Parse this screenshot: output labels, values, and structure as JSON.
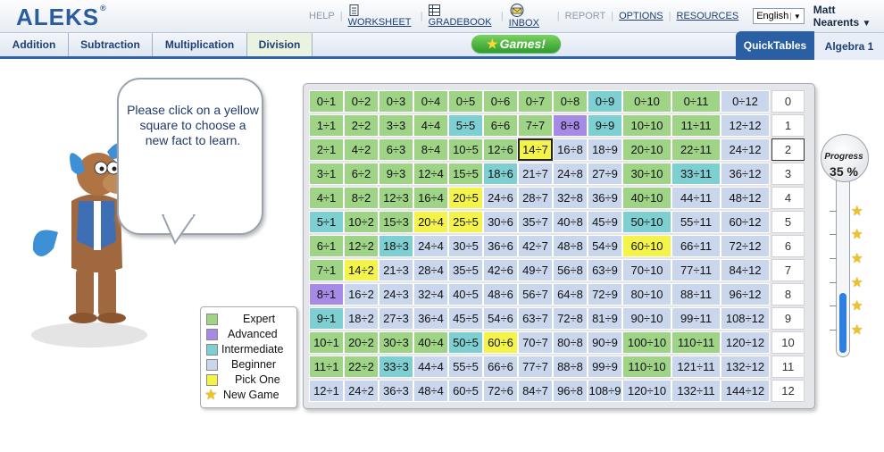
{
  "header": {
    "logo": "ALEKS",
    "logo_mark": "®",
    "links": {
      "help": "HELP",
      "worksheet": "WORKSHEET",
      "gradebook": "GRADEBOOK",
      "inbox": "INBOX",
      "report": "REPORT",
      "options": "OPTIONS",
      "resources": "RESOURCES"
    },
    "language": "English",
    "user": "Matt Nearents"
  },
  "nav": {
    "tabs": [
      "Addition",
      "Subtraction",
      "Multiplication",
      "Division"
    ],
    "games": "Games!",
    "quicktables": "QuickTables",
    "course": "Algebra 1"
  },
  "bubble": {
    "text": "Please click on a yellow square to choose a new fact to learn."
  },
  "legend": [
    {
      "label": "Expert",
      "color": "#9fd487"
    },
    {
      "label": "Advanced",
      "color": "#a58be6"
    },
    {
      "label": "Intermediate",
      "color": "#7ecfd2"
    },
    {
      "label": "Beginner",
      "color": "#c9d6ec"
    },
    {
      "label": "Pick One",
      "color": "#f3f34a"
    },
    {
      "label": "New Game",
      "icon": "star-icon"
    }
  ],
  "progress": {
    "label": "Progress",
    "value": "35 %",
    "fraction": 0.35
  },
  "colors": {
    "E": "#9fd487",
    "A": "#a58be6",
    "I": "#7ecfd2",
    "B": "#c9d6ec",
    "P": "#f3f34a",
    "S": "#f3f34a"
  },
  "table": {
    "row_labels": [
      "0",
      "1",
      "2",
      "3",
      "4",
      "5",
      "6",
      "7",
      "8",
      "9",
      "10",
      "11",
      "12"
    ],
    "current_row": 2,
    "rows": [
      [
        [
          "0÷1",
          "E"
        ],
        [
          "0÷2",
          "E"
        ],
        [
          "0÷3",
          "E"
        ],
        [
          "0÷4",
          "E"
        ],
        [
          "0÷5",
          "E"
        ],
        [
          "0÷6",
          "E"
        ],
        [
          "0÷7",
          "E"
        ],
        [
          "0÷8",
          "E"
        ],
        [
          "0÷9",
          "I"
        ],
        [
          "0÷10",
          "E"
        ],
        [
          "0÷11",
          "E"
        ],
        [
          "0÷12",
          "B"
        ]
      ],
      [
        [
          "1÷1",
          "E"
        ],
        [
          "2÷2",
          "E"
        ],
        [
          "3÷3",
          "E"
        ],
        [
          "4÷4",
          "E"
        ],
        [
          "5÷5",
          "I"
        ],
        [
          "6÷6",
          "E"
        ],
        [
          "7÷7",
          "E"
        ],
        [
          "8÷8",
          "A"
        ],
        [
          "9÷9",
          "I"
        ],
        [
          "10÷10",
          "E"
        ],
        [
          "11÷11",
          "E"
        ],
        [
          "12÷12",
          "B"
        ]
      ],
      [
        [
          "2÷1",
          "E"
        ],
        [
          "4÷2",
          "E"
        ],
        [
          "6÷3",
          "E"
        ],
        [
          "8÷4",
          "E"
        ],
        [
          "10÷5",
          "E"
        ],
        [
          "12÷6",
          "E"
        ],
        [
          "14÷7",
          "S"
        ],
        [
          "16÷8",
          "B"
        ],
        [
          "18÷9",
          "B"
        ],
        [
          "20÷10",
          "E"
        ],
        [
          "22÷11",
          "E"
        ],
        [
          "24÷12",
          "B"
        ]
      ],
      [
        [
          "3÷1",
          "E"
        ],
        [
          "6÷2",
          "E"
        ],
        [
          "9÷3",
          "E"
        ],
        [
          "12÷4",
          "E"
        ],
        [
          "15÷5",
          "E"
        ],
        [
          "18÷6",
          "I"
        ],
        [
          "21÷7",
          "B"
        ],
        [
          "24÷8",
          "B"
        ],
        [
          "27÷9",
          "B"
        ],
        [
          "30÷10",
          "E"
        ],
        [
          "33÷11",
          "I"
        ],
        [
          "36÷12",
          "B"
        ]
      ],
      [
        [
          "4÷1",
          "E"
        ],
        [
          "8÷2",
          "E"
        ],
        [
          "12÷3",
          "E"
        ],
        [
          "16÷4",
          "E"
        ],
        [
          "20÷5",
          "P"
        ],
        [
          "24÷6",
          "B"
        ],
        [
          "28÷7",
          "B"
        ],
        [
          "32÷8",
          "B"
        ],
        [
          "36÷9",
          "B"
        ],
        [
          "40÷10",
          "E"
        ],
        [
          "44÷11",
          "B"
        ],
        [
          "48÷12",
          "B"
        ]
      ],
      [
        [
          "5÷1",
          "I"
        ],
        [
          "10÷2",
          "E"
        ],
        [
          "15÷3",
          "E"
        ],
        [
          "20÷4",
          "P"
        ],
        [
          "25÷5",
          "P"
        ],
        [
          "30÷6",
          "B"
        ],
        [
          "35÷7",
          "B"
        ],
        [
          "40÷8",
          "B"
        ],
        [
          "45÷9",
          "B"
        ],
        [
          "50÷10",
          "I"
        ],
        [
          "55÷11",
          "B"
        ],
        [
          "60÷12",
          "B"
        ]
      ],
      [
        [
          "6÷1",
          "E"
        ],
        [
          "12÷2",
          "E"
        ],
        [
          "18÷3",
          "I"
        ],
        [
          "24÷4",
          "B"
        ],
        [
          "30÷5",
          "B"
        ],
        [
          "36÷6",
          "B"
        ],
        [
          "42÷7",
          "B"
        ],
        [
          "48÷8",
          "B"
        ],
        [
          "54÷9",
          "B"
        ],
        [
          "60÷10",
          "P"
        ],
        [
          "66÷11",
          "B"
        ],
        [
          "72÷12",
          "B"
        ]
      ],
      [
        [
          "7÷1",
          "E"
        ],
        [
          "14÷2",
          "P"
        ],
        [
          "21÷3",
          "B"
        ],
        [
          "28÷4",
          "B"
        ],
        [
          "35÷5",
          "B"
        ],
        [
          "42÷6",
          "B"
        ],
        [
          "49÷7",
          "B"
        ],
        [
          "56÷8",
          "B"
        ],
        [
          "63÷9",
          "B"
        ],
        [
          "70÷10",
          "B"
        ],
        [
          "77÷11",
          "B"
        ],
        [
          "84÷12",
          "B"
        ]
      ],
      [
        [
          "8÷1",
          "A"
        ],
        [
          "16÷2",
          "B"
        ],
        [
          "24÷3",
          "B"
        ],
        [
          "32÷4",
          "B"
        ],
        [
          "40÷5",
          "B"
        ],
        [
          "48÷6",
          "B"
        ],
        [
          "56÷7",
          "B"
        ],
        [
          "64÷8",
          "B"
        ],
        [
          "72÷9",
          "B"
        ],
        [
          "80÷10",
          "B"
        ],
        [
          "88÷11",
          "B"
        ],
        [
          "96÷12",
          "B"
        ]
      ],
      [
        [
          "9÷1",
          "I"
        ],
        [
          "18÷2",
          "B"
        ],
        [
          "27÷3",
          "B"
        ],
        [
          "36÷4",
          "B"
        ],
        [
          "45÷5",
          "B"
        ],
        [
          "54÷6",
          "B"
        ],
        [
          "63÷7",
          "B"
        ],
        [
          "72÷8",
          "B"
        ],
        [
          "81÷9",
          "B"
        ],
        [
          "90÷10",
          "B"
        ],
        [
          "99÷11",
          "B"
        ],
        [
          "108÷12",
          "B"
        ]
      ],
      [
        [
          "10÷1",
          "E"
        ],
        [
          "20÷2",
          "E"
        ],
        [
          "30÷3",
          "E"
        ],
        [
          "40÷4",
          "E"
        ],
        [
          "50÷5",
          "I"
        ],
        [
          "60÷6",
          "P"
        ],
        [
          "70÷7",
          "B"
        ],
        [
          "80÷8",
          "B"
        ],
        [
          "90÷9",
          "B"
        ],
        [
          "100÷10",
          "E"
        ],
        [
          "110÷11",
          "E"
        ],
        [
          "120÷12",
          "B"
        ]
      ],
      [
        [
          "11÷1",
          "E"
        ],
        [
          "22÷2",
          "E"
        ],
        [
          "33÷3",
          "I"
        ],
        [
          "44÷4",
          "B"
        ],
        [
          "55÷5",
          "B"
        ],
        [
          "66÷6",
          "B"
        ],
        [
          "77÷7",
          "B"
        ],
        [
          "88÷8",
          "B"
        ],
        [
          "99÷9",
          "B"
        ],
        [
          "110÷10",
          "E"
        ],
        [
          "121÷11",
          "B"
        ],
        [
          "132÷12",
          "B"
        ]
      ],
      [
        [
          "12÷1",
          "B"
        ],
        [
          "24÷2",
          "B"
        ],
        [
          "36÷3",
          "B"
        ],
        [
          "48÷4",
          "B"
        ],
        [
          "60÷5",
          "B"
        ],
        [
          "72÷6",
          "B"
        ],
        [
          "84÷7",
          "B"
        ],
        [
          "96÷8",
          "B"
        ],
        [
          "108÷9",
          "B"
        ],
        [
          "120÷10",
          "B"
        ],
        [
          "132÷11",
          "B"
        ],
        [
          "144÷12",
          "B"
        ]
      ]
    ]
  }
}
